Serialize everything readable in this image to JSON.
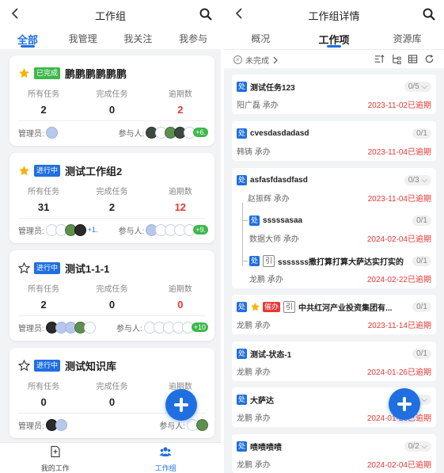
{
  "left": {
    "nav": {
      "title": "工作组"
    },
    "tabs": [
      "全部",
      "我管理",
      "我关注",
      "我参与"
    ],
    "stat_labels": {
      "all": "所有任务",
      "done": "完成任务",
      "overdue": "逾期数"
    },
    "manager_label": "管理员:",
    "member_label": "参与人:",
    "cards": [
      {
        "starred": true,
        "status": "已完成",
        "status_color": "#3db84b",
        "title": "鹏鹏鹏鹏鹏鹏",
        "all": "2",
        "done": "0",
        "overdue": "2",
        "member_more": "+6."
      },
      {
        "starred": true,
        "status": "进行中",
        "status_color": "#1f6fe0",
        "title": "测试工作组2",
        "all": "31",
        "done": "2",
        "overdue": "12",
        "manager_more": "+1.",
        "member_more": "+9."
      },
      {
        "starred": false,
        "status": "进行中",
        "status_color": "#1f6fe0",
        "title": "测试1-1-1",
        "all": "2",
        "done": "0",
        "overdue": "0",
        "member_more": "+10"
      },
      {
        "starred": false,
        "status": "进行中",
        "status_color": "#1f6fe0",
        "title": "测试知识库",
        "all": "0",
        "done": "0",
        "overdue": ""
      }
    ],
    "bottombar": [
      "我的工作",
      "工作组"
    ]
  },
  "right": {
    "nav": {
      "title": "工作组详情"
    },
    "tabs": [
      "概况",
      "工作项",
      "资源库"
    ],
    "filter_label": "未完成",
    "tasks": [
      {
        "tag": "处",
        "name": "测试任务123",
        "count": "0/5",
        "who": "阳广磊 承办",
        "due": "2023-11-02已逾期"
      },
      {
        "tag": "处",
        "name": "cvesdasdadasd",
        "count": "0/1",
        "who": "韩铸 承办",
        "due": "2023-11-04已逾期"
      },
      {
        "tag": "处",
        "name": "asfasfdasdfasd",
        "count": "0/3",
        "who": "赵振辉 承办",
        "due": "2023-11-04已逾期",
        "subs": [
          {
            "tag": "处",
            "name": "sssssasaa",
            "count": "0/1",
            "who": "数据大师 承办",
            "due": "2024-02-04已逾期"
          },
          {
            "tag": "处",
            "ref": "引",
            "name": "sssssss撒打算打算大萨达实打实的",
            "count": "0/1",
            "who": "龙鹏 承办",
            "due": "2024-02-22已逾期"
          }
        ]
      },
      {
        "tag": "处",
        "urge": "催办",
        "ref": "引",
        "name": "中共红河产业投资集团有...",
        "count": "0/1",
        "who": "龙鹏 承办",
        "due": "2023-11-14已逾期"
      },
      {
        "tag": "处",
        "name": "测试-状态-1",
        "count": "0/1",
        "who": "龙鹏 承办",
        "due": "2024-01-26已逾期"
      },
      {
        "tag": "处",
        "name": "大萨达",
        "who": "龙鹏 承办",
        "due": "2024-01-26已逾期"
      },
      {
        "tag": "处",
        "name": "啧啧啧啧",
        "count": "0/2",
        "who": "龙鹏 承办",
        "due": "2024-02-04已逾期"
      }
    ]
  }
}
